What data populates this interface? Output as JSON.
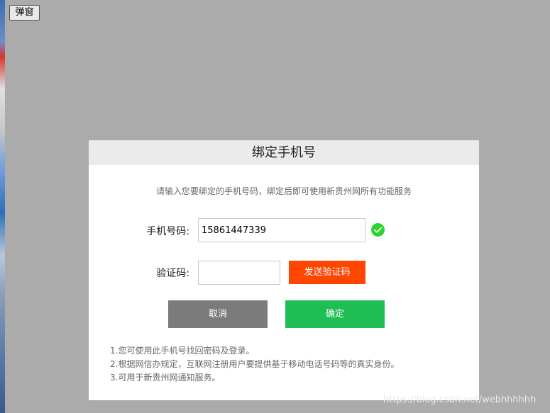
{
  "page": {
    "open_button_label": "弹窗",
    "watermark": "https://blog.csdn.net/webhhhhhh"
  },
  "modal": {
    "title": "绑定手机号",
    "notice": "请输入您要绑定的手机号码，绑定后即可使用新贵州网所有功能服务",
    "phone_label": "手机号码:",
    "phone_value": "15861447339",
    "code_label": "验证码:",
    "code_value": "",
    "send_code_label": "发送验证码",
    "cancel_label": "取消",
    "confirm_label": "确定",
    "notes": [
      "1.您可使用此手机号找回密码及登录。",
      "2.根据网信办规定，互联网注册用户要提供基于移动电话号码等的真实身份。",
      "3.可用于新贵州网通知服务。"
    ]
  },
  "colors": {
    "overlay": "#ababab",
    "header_bg": "#ebebeb",
    "send_button": "#ff4500",
    "cancel_button": "#7b7b7b",
    "confirm_button": "#1fbe55",
    "valid_check": "#2bd52b"
  },
  "icons": {
    "phone_valid": "check-circle-icon"
  }
}
